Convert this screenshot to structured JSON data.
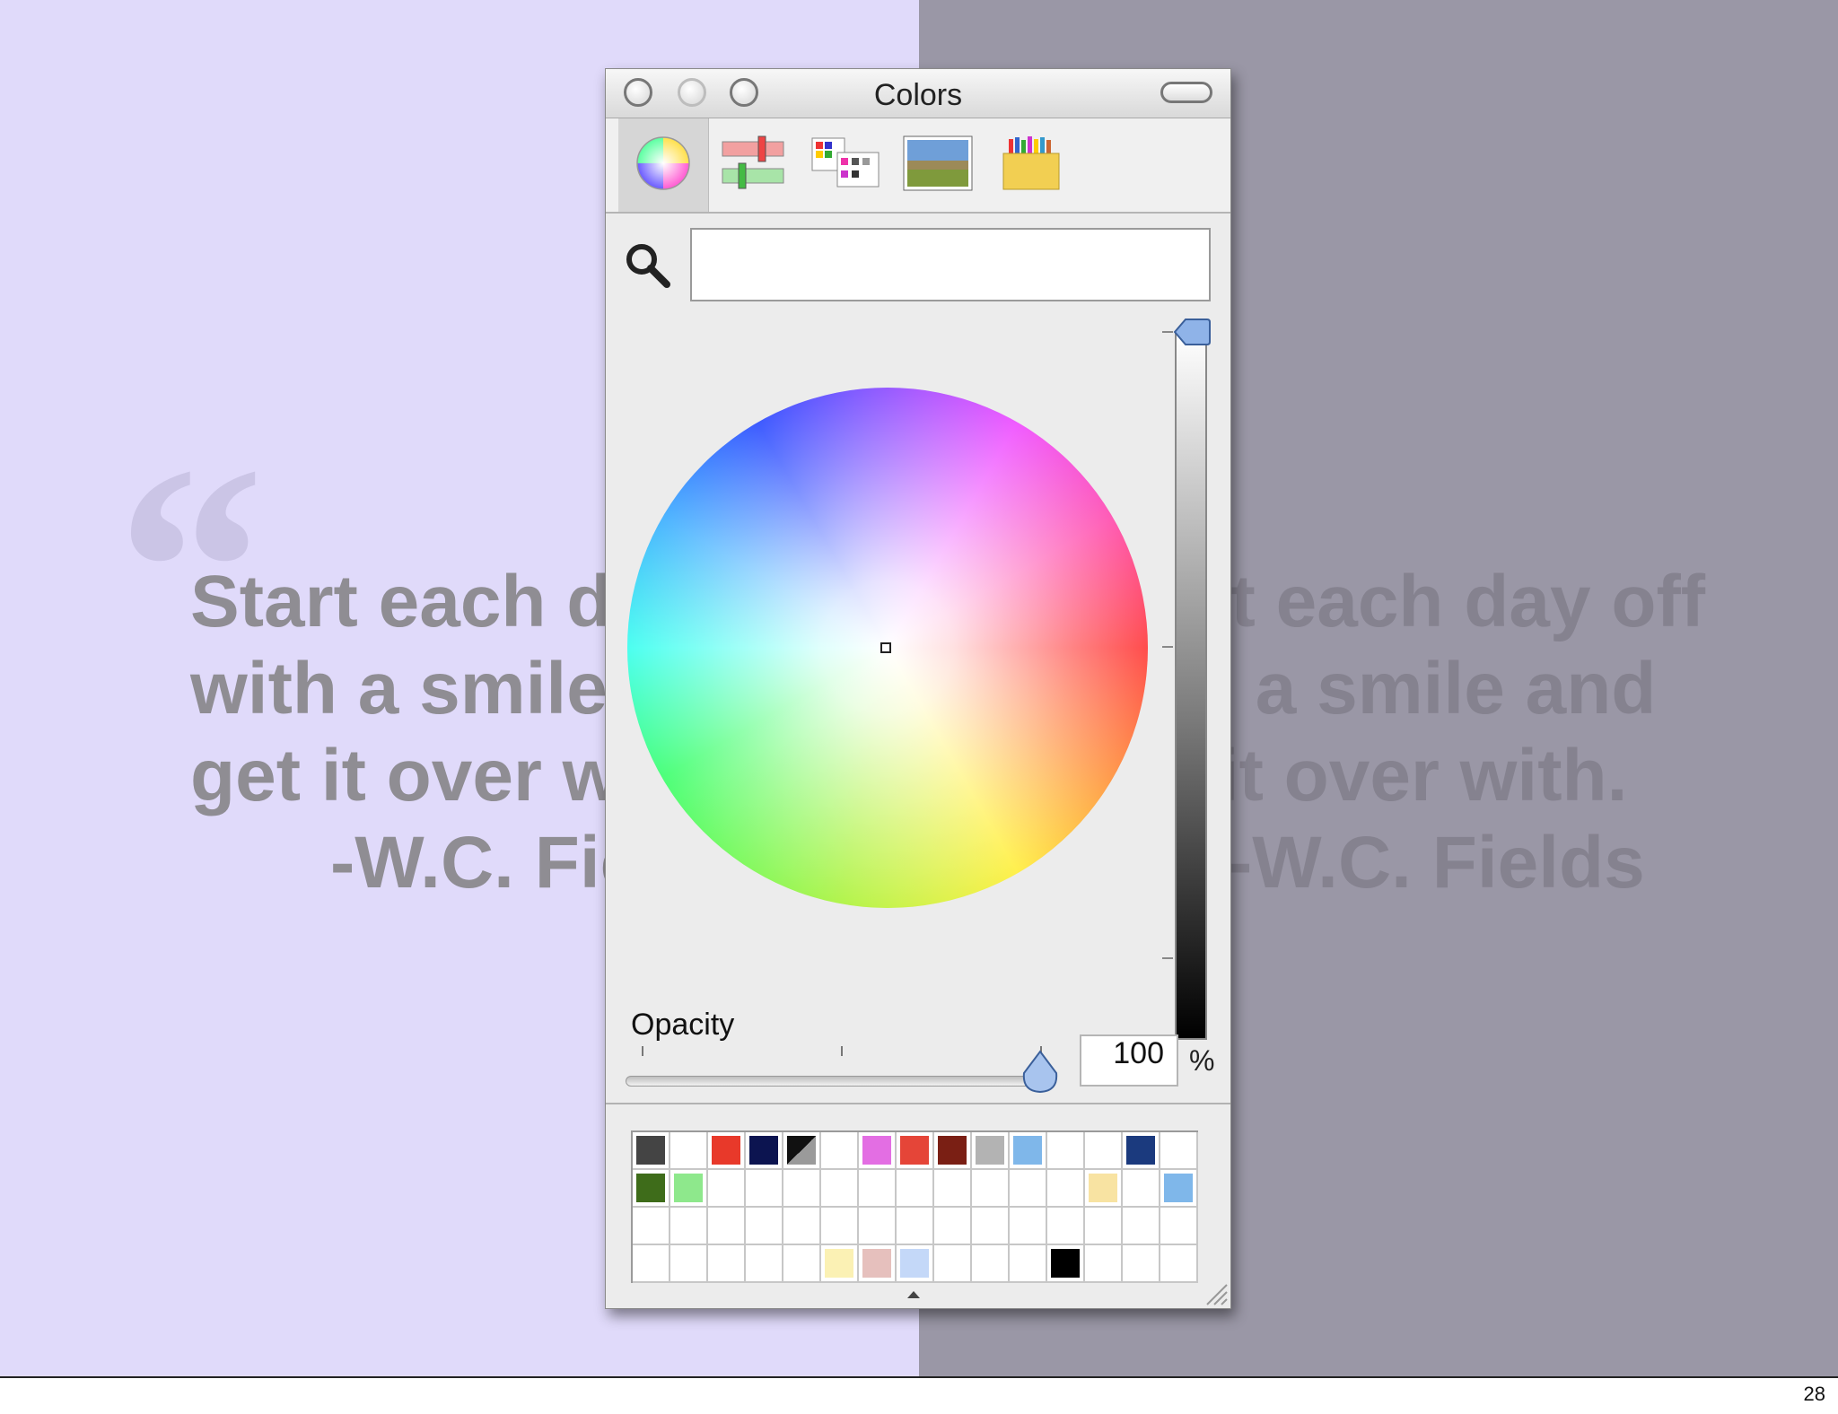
{
  "slide": {
    "quote_mark": "“",
    "quote_lines": [
      "Start each day off",
      "with a smile and",
      "get it over with."
    ],
    "author": "-W.C. Fields",
    "page_number": "28"
  },
  "colors": {
    "background_left": "#e0dafa",
    "background_right": "#9a97a6",
    "quote_text": "#8f8d93"
  },
  "window": {
    "title": "Colors",
    "toolbar": [
      {
        "name": "color-wheel",
        "icon": "color-wheel-icon",
        "selected": true
      },
      {
        "name": "color-sliders",
        "icon": "sliders-icon",
        "selected": false
      },
      {
        "name": "color-palettes",
        "icon": "palette-icon",
        "selected": false
      },
      {
        "name": "image-palettes",
        "icon": "landscape-image-icon",
        "selected": false
      },
      {
        "name": "crayons",
        "icon": "crayon-box-icon",
        "selected": false
      }
    ],
    "search": {
      "value": "",
      "placeholder": ""
    },
    "brightness_fraction": 1.0,
    "opacity": {
      "label": "Opacity",
      "value": "100",
      "unit": "%",
      "fraction": 1.0
    },
    "swatches": [
      [
        "#444444",
        "",
        "#e8392a",
        "#0c1450",
        "split",
        "",
        "#e36ee3",
        "#e54538",
        "#7a1f14",
        "#b3b3b3",
        "#7fb7ea",
        "",
        "",
        "#1b3a7e",
        ""
      ],
      [
        "#3e6c1a",
        "#8ee88c",
        "",
        "",
        "",
        "",
        "",
        "",
        "",
        "",
        "",
        "",
        "#f8e3a2",
        "",
        "#7fb7ea"
      ],
      [
        "",
        "",
        "",
        "",
        "",
        "",
        "",
        "",
        "",
        "",
        "",
        "",
        "",
        "",
        ""
      ],
      [
        "",
        "",
        "",
        "",
        "",
        "#fbf1b4",
        "#e6c0bd",
        "#c4d8f8",
        "",
        "",
        "",
        "#000000",
        "",
        "",
        ""
      ]
    ]
  }
}
